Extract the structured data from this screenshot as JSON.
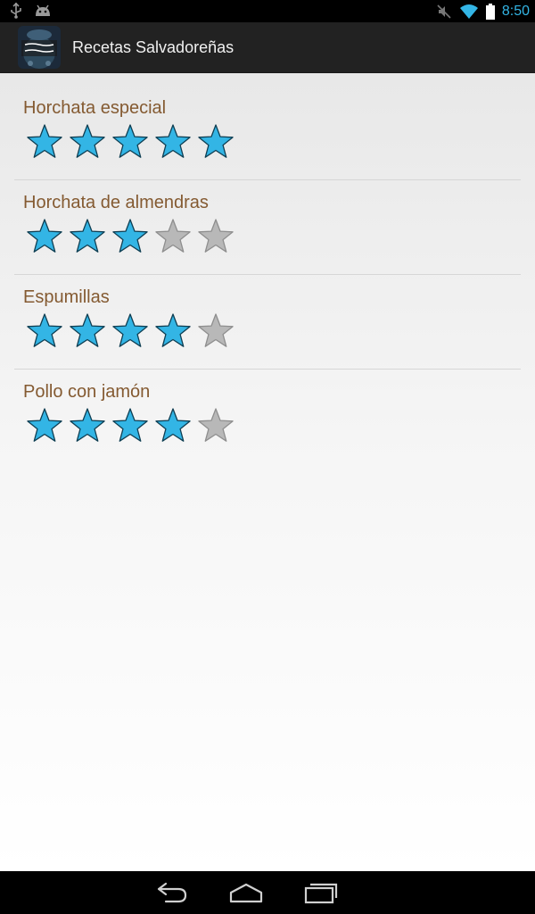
{
  "status_bar": {
    "time": "8:50",
    "icons": [
      "usb-icon",
      "android-icon",
      "mute-icon",
      "wifi-icon",
      "battery-icon"
    ]
  },
  "action_bar": {
    "title": "Recetas Salvadoreñas",
    "logo_icon": "app-logo-icon"
  },
  "recipes": [
    {
      "name": "Horchata especial",
      "rating": 5,
      "max": 5
    },
    {
      "name": "Horchata de almendras",
      "rating": 3,
      "max": 5
    },
    {
      "name": "Espumillas",
      "rating": 4,
      "max": 5
    },
    {
      "name": "Pollo con jamón",
      "rating": 4,
      "max": 5
    }
  ],
  "colors": {
    "accent": "#33b5e5",
    "star_filled": "#33b5e5",
    "star_empty": "#b8b8b8",
    "recipe_text": "#845a31"
  },
  "nav_bar": {
    "icons": [
      "back-icon",
      "home-icon",
      "recent-apps-icon"
    ]
  }
}
